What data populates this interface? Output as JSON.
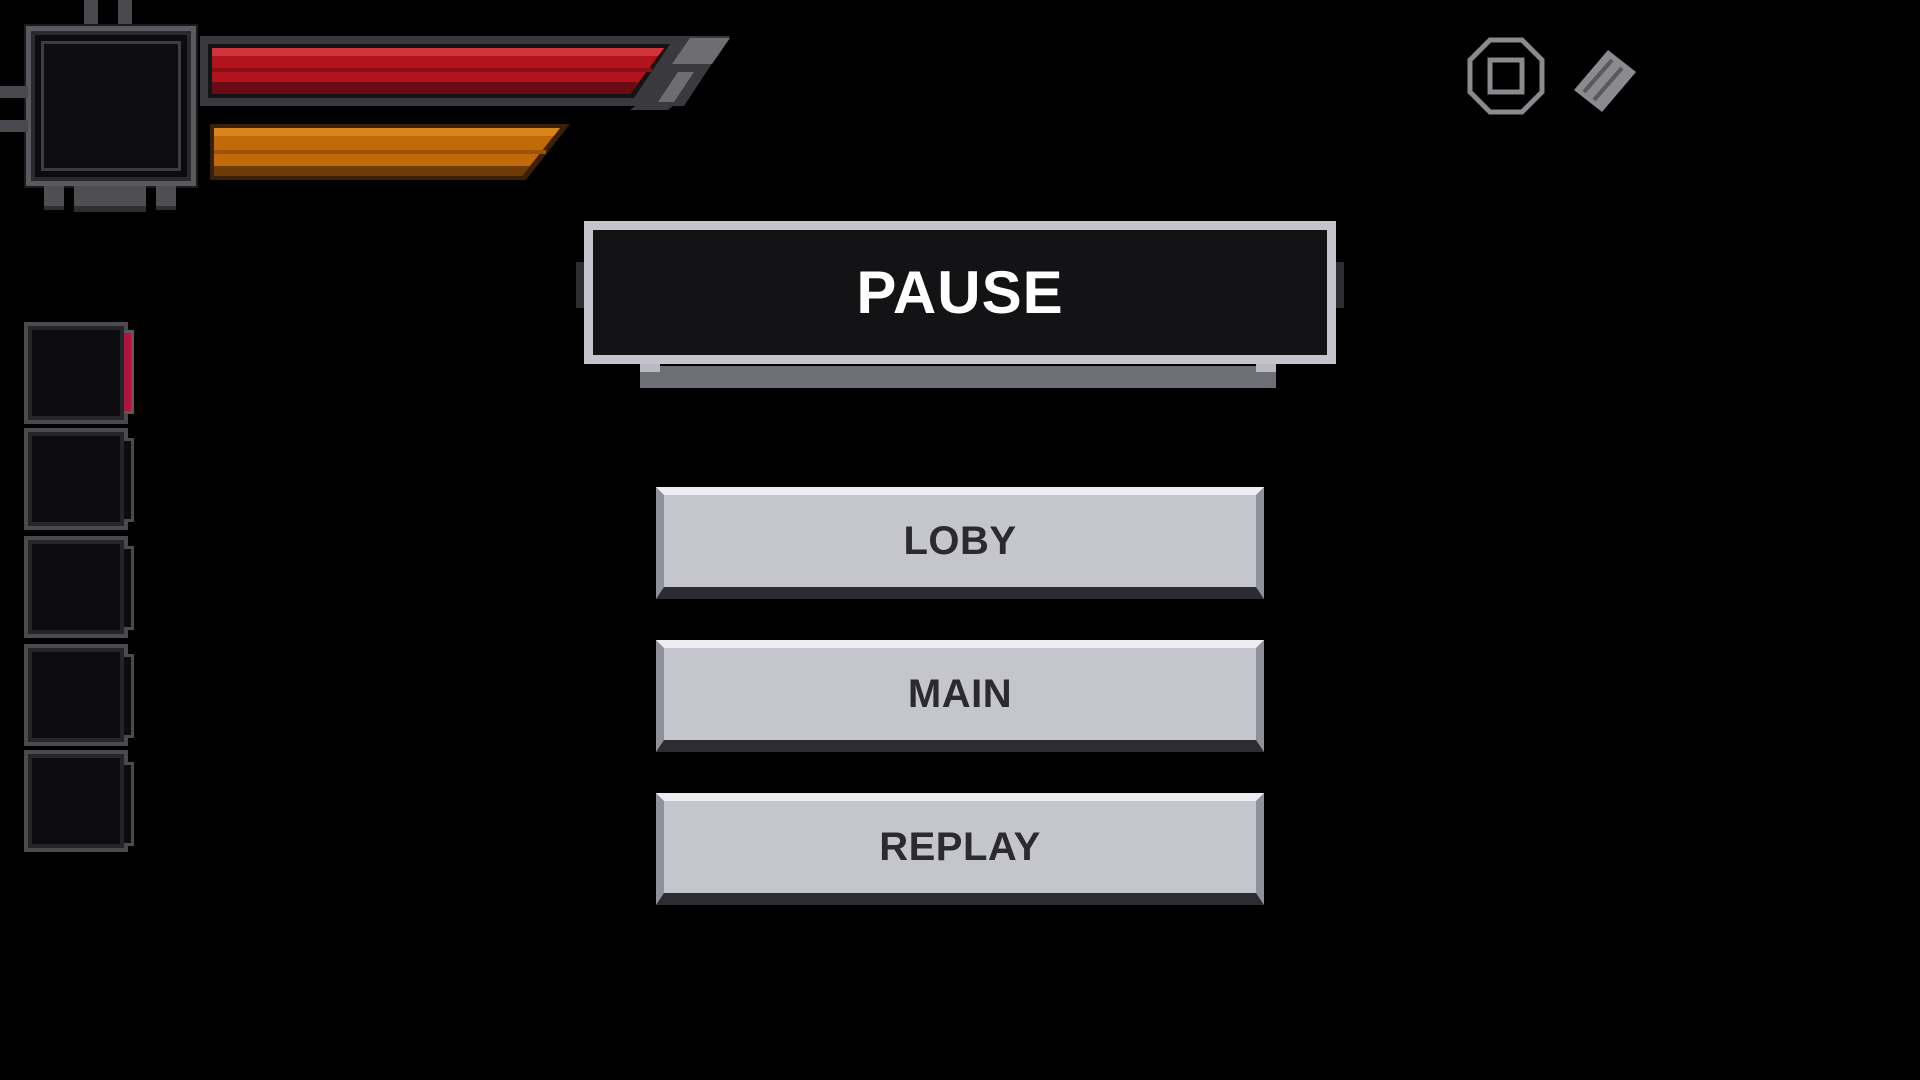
{
  "pause": {
    "title": "PAUSE"
  },
  "menu": {
    "buttons": [
      {
        "label": "LOBY"
      },
      {
        "label": "MAIN"
      },
      {
        "label": "REPLAY"
      }
    ]
  },
  "hud": {
    "health_bar": {
      "color": "#b3141c",
      "fill": 1.0
    },
    "stamina_bar": {
      "color": "#c06a0a",
      "fill": 1.0
    },
    "inventory_slots": 5,
    "active_slot_indicator_color": "#b0143c"
  },
  "top_right_icons": [
    {
      "name": "stop-icon"
    },
    {
      "name": "ticket-icon"
    }
  ]
}
